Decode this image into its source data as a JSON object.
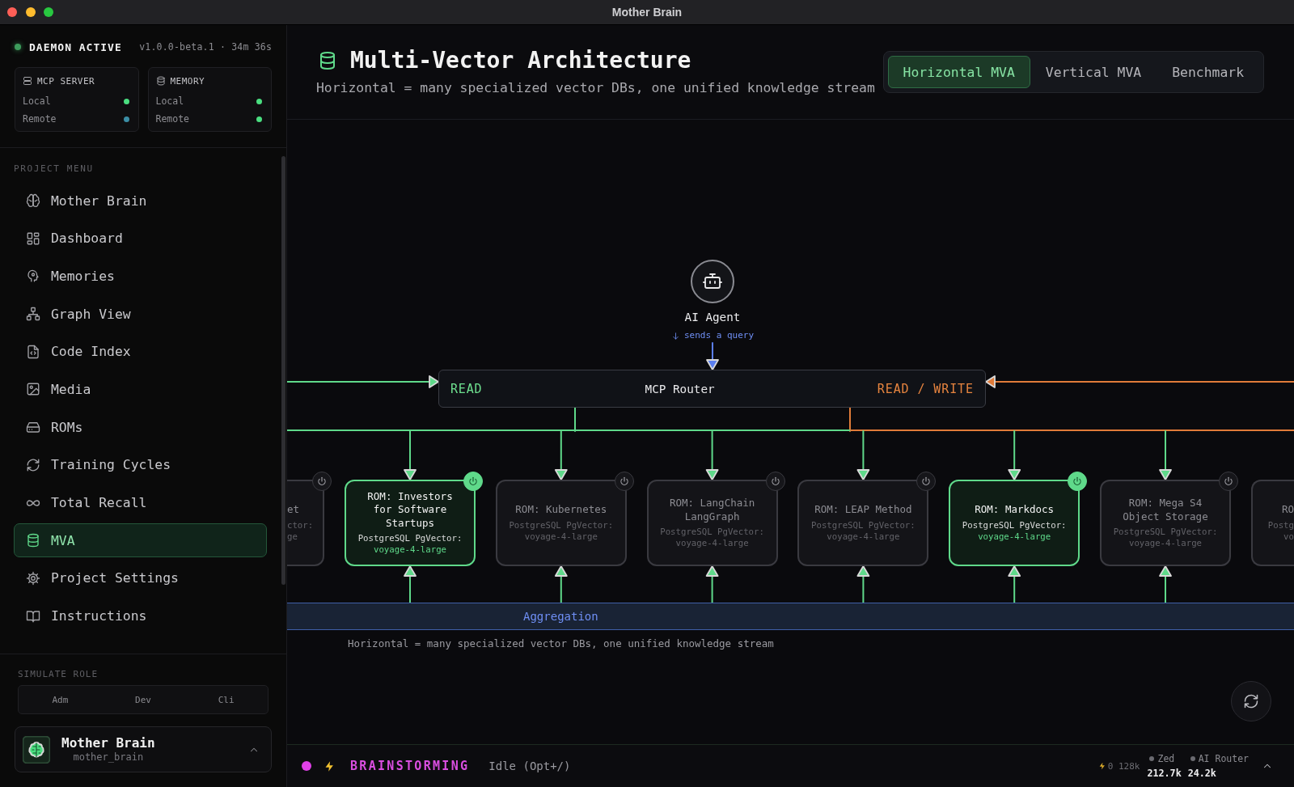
{
  "window": {
    "title": "Mother Brain"
  },
  "sidebar": {
    "daemon": {
      "label": "DAEMON ACTIVE",
      "active": true,
      "meta": "v1.0.0-beta.1 · 34m 36s"
    },
    "services": [
      {
        "title": "MCP SERVER",
        "rows": [
          {
            "label": "Local",
            "color": "#4ade80"
          },
          {
            "label": "Remote",
            "color": "#3b8ea5"
          }
        ]
      },
      {
        "title": "MEMORY",
        "rows": [
          {
            "label": "Local",
            "color": "#4ade80"
          },
          {
            "label": "Remote",
            "color": "#4ade80"
          }
        ]
      }
    ],
    "menu_title": "PROJECT MENU",
    "menu": [
      {
        "label": "Mother Brain",
        "selected": false
      },
      {
        "label": "Dashboard",
        "selected": false
      },
      {
        "label": "Memories",
        "selected": false
      },
      {
        "label": "Graph View",
        "selected": false
      },
      {
        "label": "Code Index",
        "selected": false
      },
      {
        "label": "Media",
        "selected": false
      },
      {
        "label": "ROMs",
        "selected": false
      },
      {
        "label": "Training Cycles",
        "selected": false
      },
      {
        "label": "Total Recall",
        "selected": false
      },
      {
        "label": "MVA",
        "selected": true
      },
      {
        "label": "Project Settings",
        "selected": false
      },
      {
        "label": "Instructions",
        "selected": false
      }
    ],
    "role_title": "SIMULATE ROLE",
    "roles": [
      "Adm",
      "Dev",
      "Cli"
    ],
    "profile": {
      "name": "Mother Brain",
      "handle": "mother_brain"
    }
  },
  "header": {
    "title": "Multi-Vector Architecture",
    "subtitle": "Horizontal = many specialized vector DBs, one unified knowledge stream",
    "tabs": [
      {
        "label": "Horizontal MVA",
        "selected": true
      },
      {
        "label": "Vertical MVA",
        "selected": false
      },
      {
        "label": "Benchmark",
        "selected": false
      }
    ]
  },
  "diagram": {
    "agent": {
      "label": "AI Agent",
      "hint": "sends a query"
    },
    "router": {
      "label": "MCP Router",
      "read": "READ",
      "read_write": "READ / WRITE"
    },
    "roms": [
      {
        "kind": "cut_left",
        "title": "et",
        "store": "ctor:",
        "model": "ge",
        "active": false
      },
      {
        "kind": "full",
        "title": "ROM: Investors for Software Startups",
        "store": "PostgreSQL PgVector:",
        "model": "voyage-4-large",
        "active": true
      },
      {
        "kind": "full",
        "title": "ROM: Kubernetes",
        "store": "PostgreSQL PgVector:",
        "model": "voyage-4-large",
        "active": false
      },
      {
        "kind": "full",
        "title": "ROM: LangChain LangGraph",
        "store": "PostgreSQL PgVector:",
        "model": "voyage-4-large",
        "active": false
      },
      {
        "kind": "full",
        "title": "ROM: LEAP Method",
        "store": "PostgreSQL PgVector:",
        "model": "voyage-4-large",
        "active": false
      },
      {
        "kind": "full",
        "title": "ROM: Markdocs",
        "store": "PostgreSQL PgVector:",
        "model": "voyage-4-large",
        "active": true
      },
      {
        "kind": "full",
        "title": "ROM: Mega S4 Object Storage",
        "store": "PostgreSQL PgVector:",
        "model": "voyage-4-large",
        "active": false
      },
      {
        "kind": "cut_right",
        "title": "RO",
        "store": "Postg",
        "model": "vo",
        "active": false
      }
    ],
    "aggregation": "Aggregation",
    "caption": "Horizontal = many specialized vector DBs, one unified knowledge stream"
  },
  "status_bar": {
    "mode": "BRAINSTORMING",
    "state": "Idle (Opt+/)",
    "tokens": "0 128k",
    "meters": [
      {
        "name": "Zed",
        "value": "212.7k"
      },
      {
        "name": "AI Router",
        "value": "24.2k"
      }
    ]
  }
}
